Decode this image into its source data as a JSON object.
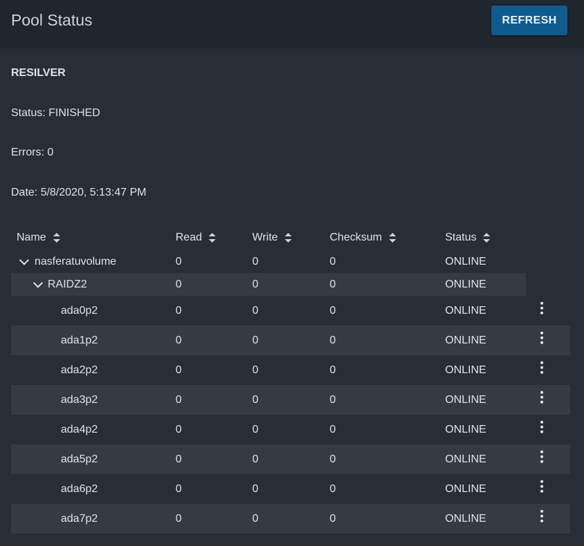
{
  "header": {
    "title": "Pool Status",
    "refresh_label": "REFRESH"
  },
  "scan": {
    "title": "RESILVER",
    "status": "Status: FINISHED",
    "errors": "Errors: 0",
    "date": "Date: 5/8/2020, 5:13:47 PM"
  },
  "table": {
    "columns": [
      "Name",
      "Read",
      "Write",
      "Checksum",
      "Status"
    ],
    "pool": {
      "name": "nasferatuvolume",
      "read": "0",
      "write": "0",
      "checksum": "0",
      "status": "ONLINE"
    },
    "vdev": {
      "name": "RAIDZ2",
      "read": "0",
      "write": "0",
      "checksum": "0",
      "status": "ONLINE"
    },
    "disks": [
      {
        "name": "ada0p2",
        "read": "0",
        "write": "0",
        "checksum": "0",
        "status": "ONLINE"
      },
      {
        "name": "ada1p2",
        "read": "0",
        "write": "0",
        "checksum": "0",
        "status": "ONLINE"
      },
      {
        "name": "ada2p2",
        "read": "0",
        "write": "0",
        "checksum": "0",
        "status": "ONLINE"
      },
      {
        "name": "ada3p2",
        "read": "0",
        "write": "0",
        "checksum": "0",
        "status": "ONLINE"
      },
      {
        "name": "ada4p2",
        "read": "0",
        "write": "0",
        "checksum": "0",
        "status": "ONLINE"
      },
      {
        "name": "ada5p2",
        "read": "0",
        "write": "0",
        "checksum": "0",
        "status": "ONLINE"
      },
      {
        "name": "ada6p2",
        "read": "0",
        "write": "0",
        "checksum": "0",
        "status": "ONLINE"
      },
      {
        "name": "ada7p2",
        "read": "0",
        "write": "0",
        "checksum": "0",
        "status": "ONLINE"
      }
    ]
  },
  "icons": {
    "sort": "sort-icon",
    "expand": "chevron-down-icon",
    "row_menu": "more-vert-icon"
  },
  "colors": {
    "background": "#262f38",
    "header": "#1f262d",
    "primary_button": "#0f5a8e",
    "row_stripe": "#333c45"
  }
}
